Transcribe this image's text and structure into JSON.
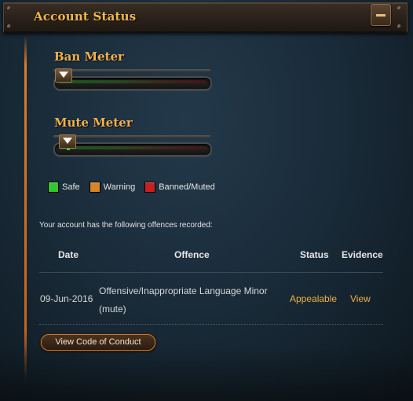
{
  "header": {
    "title": "Account Status",
    "collapse_icon": "minus-icon"
  },
  "meters": [
    {
      "title": "Ban Meter",
      "level": 0.0
    },
    {
      "title": "Mute Meter",
      "level": 0.05
    }
  ],
  "legend": [
    {
      "label": "Safe",
      "color": "#32c832"
    },
    {
      "label": "Warning",
      "color": "#d8842a"
    },
    {
      "label": "Banned/Muted",
      "color": "#c82020"
    }
  ],
  "offences": {
    "intro": "Your account has the following offences recorded:",
    "columns": {
      "date": "Date",
      "offence": "Offence",
      "status": "Status",
      "evidence": "Evidence"
    },
    "rows": [
      {
        "date": "09-Jun-2016",
        "offence_line1": "Offensive/Inappropriate Language Minor",
        "offence_line2": "(mute)",
        "status": "Appealable",
        "evidence": "View"
      }
    ]
  },
  "code_of_conduct_button": "View Code of Conduct",
  "colors": {
    "accent": "#f0b040",
    "header_text": "#f0b84a",
    "rail": "#e07a22"
  }
}
